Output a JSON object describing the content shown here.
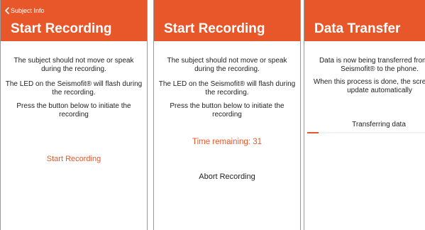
{
  "colors": {
    "accent": "#e8572a",
    "text": "#222222",
    "background": "#ffffff"
  },
  "screen1": {
    "back_label": "Subject Info",
    "title": "Start Recording",
    "para1": "The subject should not move or speak during the recording.",
    "para2": "The LED on the Seismofit® will flash during the recording.",
    "para3": "Press the button below to initiate the recording",
    "action_label": "Start Recording"
  },
  "screen2": {
    "title": "Start Recording",
    "para1": "The subject should not move or speak during the recording.",
    "para2": "The LED on the Seismofit® will flash during the recording.",
    "para3": "Press the button below to initiate the recording",
    "time_remaining": "Time remaining: 31",
    "abort_label": "Abort Recording"
  },
  "screen3": {
    "title": "Data Transfer",
    "para1": "Data is now being transferred from the Seismofit® to the phone.",
    "para2": "When this process is done, the screen will update automatically",
    "progress_label": "Transferring data",
    "progress_fraction": 0.04
  }
}
